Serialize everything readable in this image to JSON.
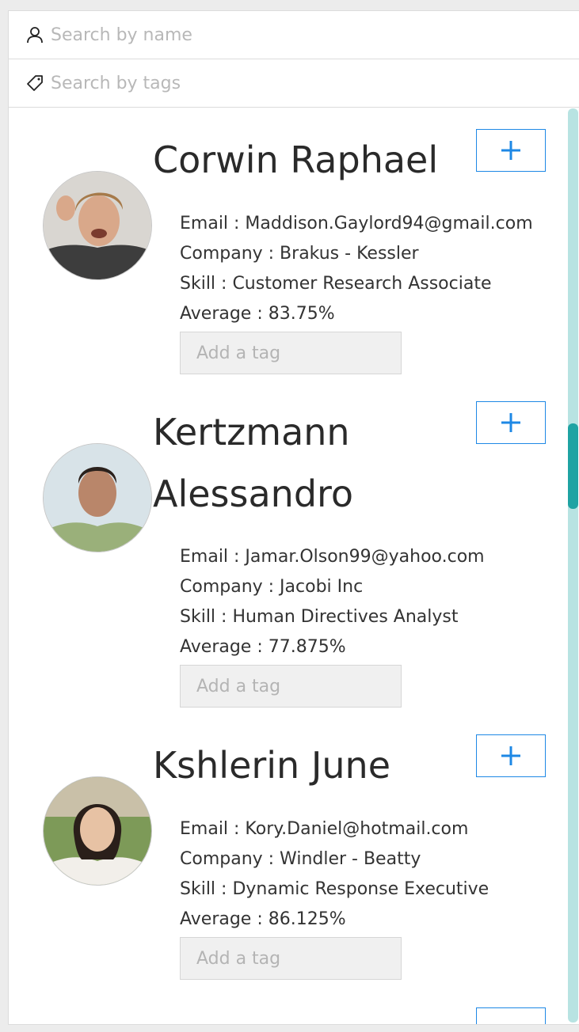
{
  "search": {
    "name_placeholder": "Search by name",
    "tags_placeholder": "Search by tags"
  },
  "colors": {
    "accent": "#1e88e5",
    "scrollbar_track": "#b8e3e2",
    "scrollbar_thumb": "#1fa3a3"
  },
  "students": [
    {
      "name": "Corwin Raphael",
      "email_label": "Email : Maddison.Gaylord94@gmail.com",
      "company_label": "Company : Brakus - Kessler",
      "skill_label": "Skill : Customer Research Associate",
      "average_label": "Average : 83.75%",
      "tag_placeholder": "Add a tag",
      "toggle_icon": "plus-icon"
    },
    {
      "name": "Kertzmann Alessandro",
      "email_label": "Email : Jamar.Olson99@yahoo.com",
      "company_label": "Company : Jacobi Inc",
      "skill_label": "Skill : Human Directives Analyst",
      "average_label": "Average : 77.875%",
      "tag_placeholder": "Add a tag",
      "toggle_icon": "plus-icon"
    },
    {
      "name": "Kshlerin June",
      "email_label": "Email : Kory.Daniel@hotmail.com",
      "company_label": "Company : Windler - Beatty",
      "skill_label": "Skill : Dynamic Response Executive",
      "average_label": "Average : 86.125%",
      "tag_placeholder": "Add a tag",
      "toggle_icon": "plus-icon"
    }
  ]
}
